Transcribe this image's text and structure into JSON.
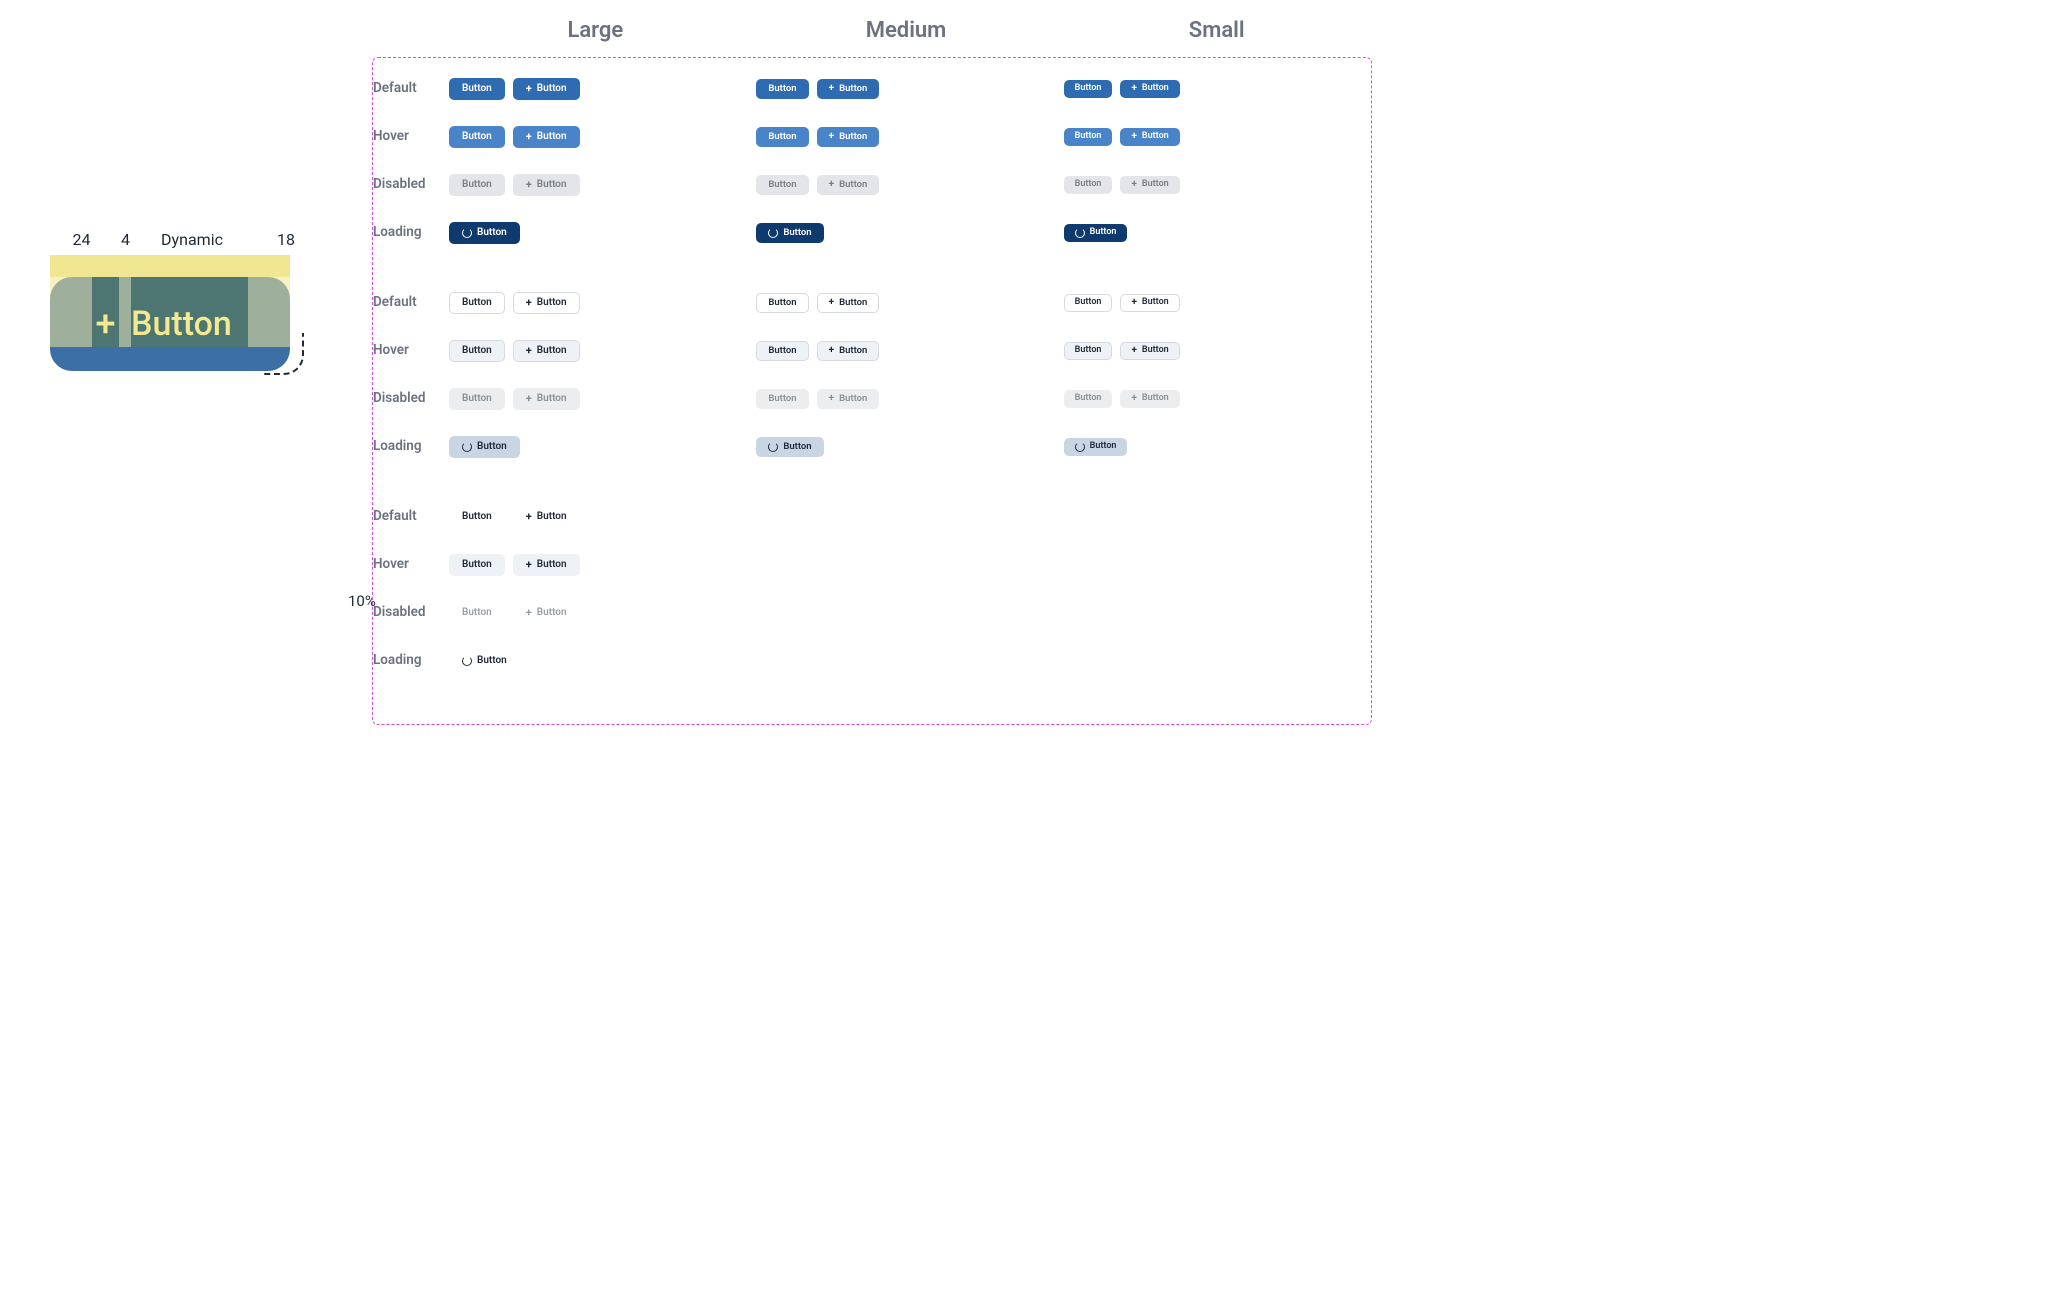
{
  "anatomy": {
    "measures": {
      "pad_l": "24",
      "gap": "4",
      "text": "Dynamic",
      "pad_r": "18"
    },
    "button_label": "Button",
    "radius": "10%"
  },
  "sizes": {
    "large": "Large",
    "medium": "Medium",
    "small": "Small"
  },
  "states": {
    "default": "Default",
    "hover": "Hover",
    "disabled": "Disabled",
    "loading": "Loading"
  },
  "label": "Button"
}
